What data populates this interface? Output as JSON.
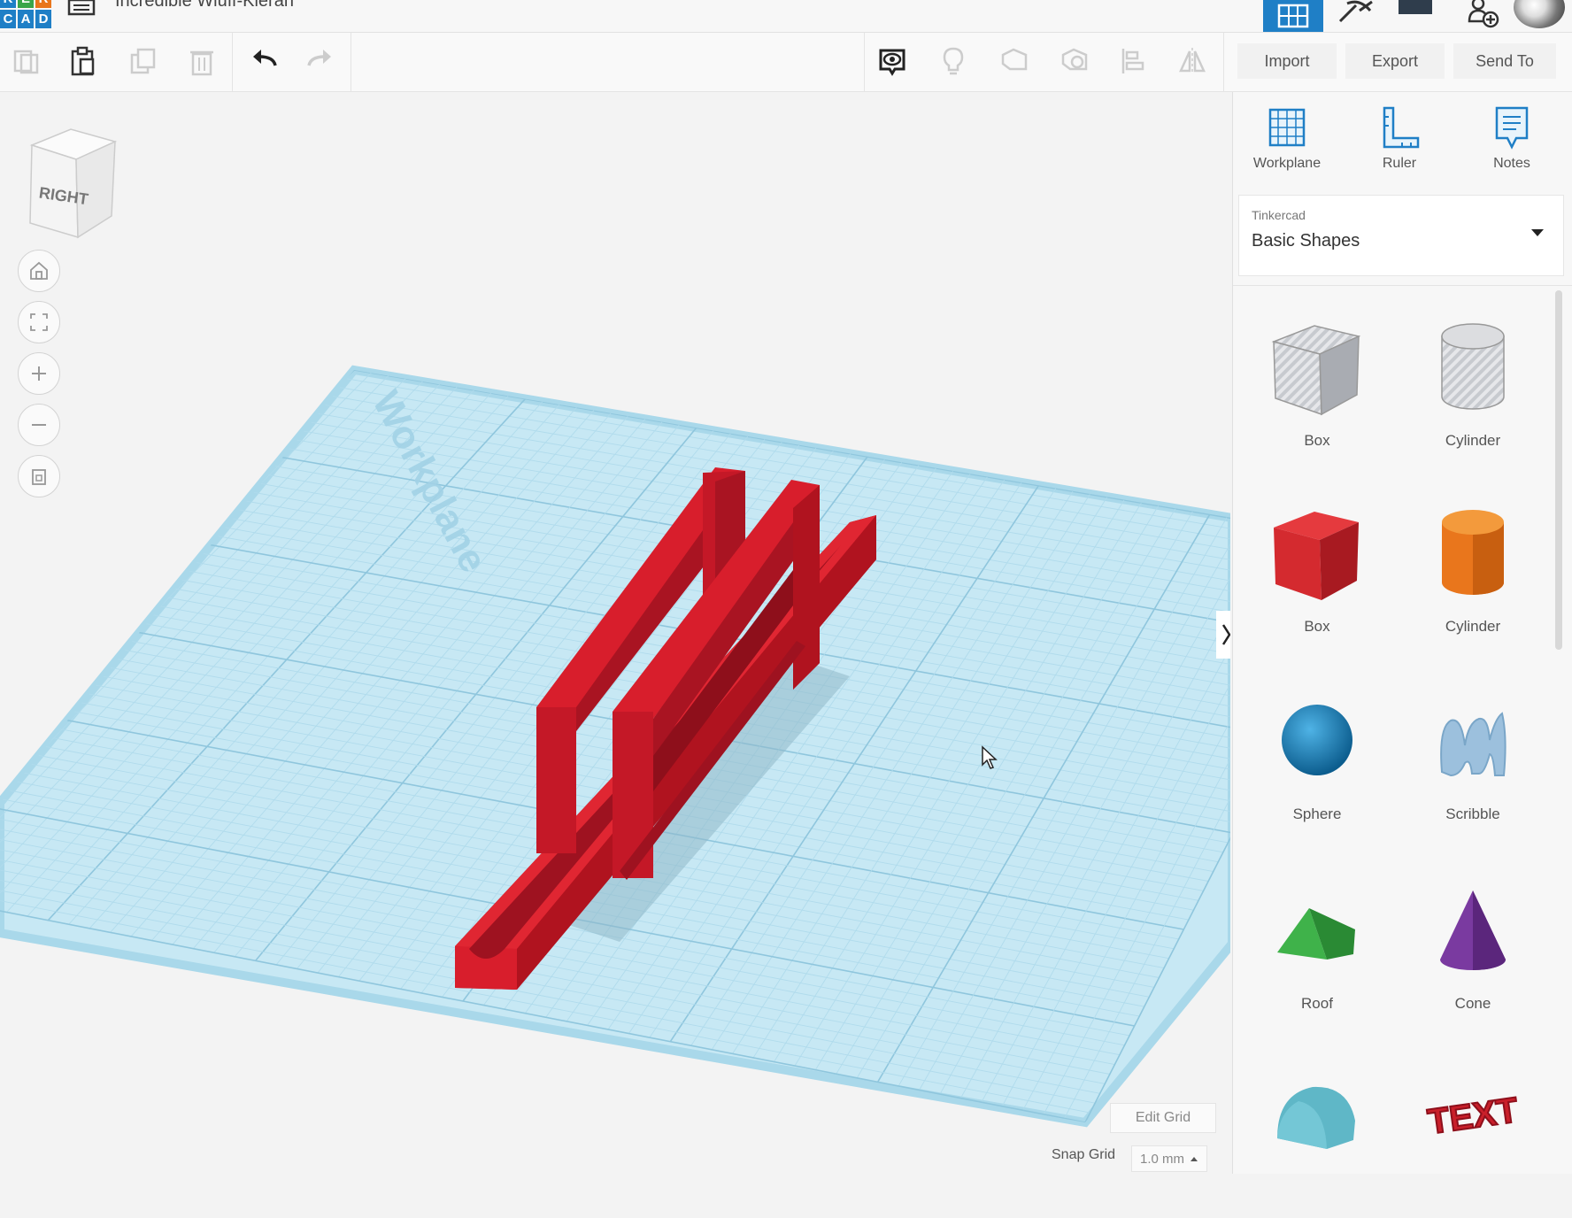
{
  "app": {
    "logo_letters": [
      "K",
      "E",
      "R",
      "C",
      "A",
      "D"
    ],
    "design_title": "Incredible Wluff-Kieran"
  },
  "toolbar": {
    "import_label": "Import",
    "export_label": "Export",
    "send_to_label": "Send To"
  },
  "viewcube": {
    "face_label": "RIGHT"
  },
  "workplane": {
    "watermark": "Workplane",
    "edit_grid_label": "Edit Grid",
    "snap_grid_label": "Snap Grid",
    "snap_grid_value": "1.0 mm"
  },
  "panel": {
    "tools": [
      {
        "label": "Workplane",
        "icon": "workplane-icon"
      },
      {
        "label": "Ruler",
        "icon": "ruler-icon"
      },
      {
        "label": "Notes",
        "icon": "notes-icon"
      }
    ],
    "library_source": "Tinkercad",
    "library_name": "Basic Shapes",
    "shapes": [
      {
        "label": "Box",
        "kind": "hole-box",
        "color": "#b8bcc2"
      },
      {
        "label": "Cylinder",
        "kind": "hole-cylinder",
        "color": "#b8bcc2"
      },
      {
        "label": "Box",
        "kind": "box",
        "color": "#d42a2f"
      },
      {
        "label": "Cylinder",
        "kind": "cylinder",
        "color": "#e9761c"
      },
      {
        "label": "Sphere",
        "kind": "sphere",
        "color": "#1b8bc9"
      },
      {
        "label": "Scribble",
        "kind": "scribble",
        "color": "#9cc0dd"
      },
      {
        "label": "Roof",
        "kind": "roof",
        "color": "#3fb24a"
      },
      {
        "label": "Cone",
        "kind": "cone",
        "color": "#7a3aa0"
      },
      {
        "label": "",
        "kind": "round-roof",
        "color": "#5fb7c7"
      },
      {
        "label": "TEXT",
        "kind": "text",
        "color": "#c91f2a"
      }
    ]
  },
  "colors": {
    "accent": "#1f7fc6",
    "model_red": "#d81e2c",
    "grid_blue": "#a9d8ea"
  }
}
